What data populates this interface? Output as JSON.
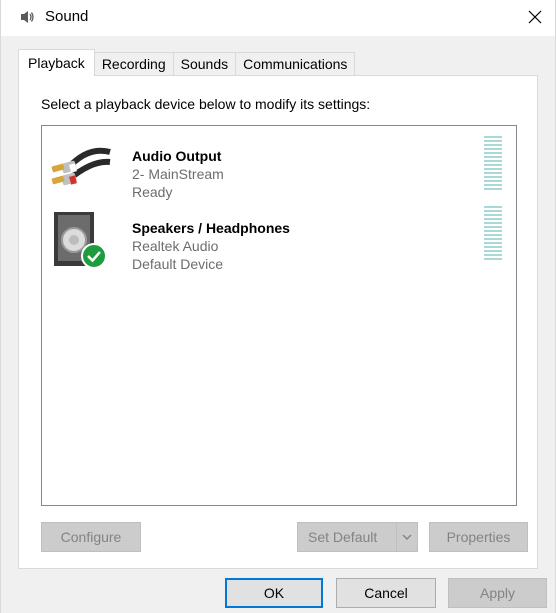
{
  "window": {
    "title": "Sound",
    "close_symbol": "✕"
  },
  "tabs": [
    {
      "label": "Playback",
      "active": true
    },
    {
      "label": "Recording",
      "active": false
    },
    {
      "label": "Sounds",
      "active": false
    },
    {
      "label": "Communications",
      "active": false
    }
  ],
  "panel": {
    "instruction": "Select a playback device below to modify its settings:"
  },
  "devices": [
    {
      "name": "Audio Output",
      "line2": "2- MainStream",
      "line3": "Ready",
      "icon": "rca-cable-icon",
      "default": false
    },
    {
      "name": "Speakers / Headphones",
      "line2": "Realtek Audio",
      "line3": "Default Device",
      "icon": "speaker-icon",
      "default": true
    }
  ],
  "panel_buttons": {
    "configure": "Configure",
    "set_default": "Set Default",
    "properties": "Properties"
  },
  "dialog_buttons": {
    "ok": "OK",
    "cancel": "Cancel",
    "apply": "Apply"
  },
  "colors": {
    "accent": "#0078d7",
    "level_meter": "#a8d8d8",
    "default_check": "#1e9b3c"
  }
}
